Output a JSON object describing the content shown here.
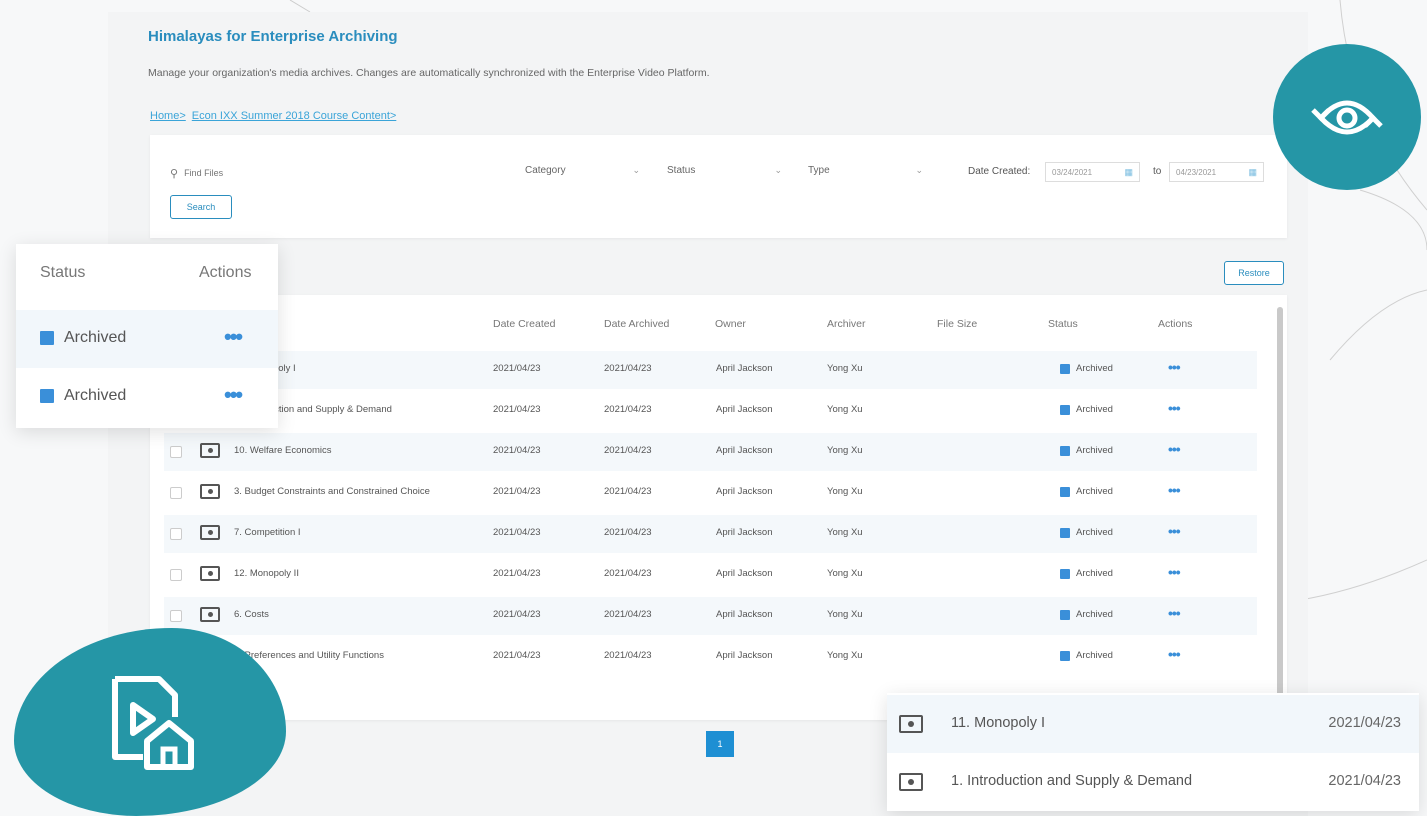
{
  "app": {
    "title": "Himalayas for Enterprise Archiving",
    "description": "Manage your organization's media archives. Changes are automatically synchronized with the Enterprise Video Platform."
  },
  "breadcrumb": [
    "Home>",
    "Econ IXX Summer 2018 Course Content>"
  ],
  "filters": {
    "search_placeholder": "Find Files",
    "category": "Category",
    "status": "Status",
    "type": "Type",
    "date_label": "Date Created:",
    "date_from": "03/24/2021",
    "date_to": "04/23/2021",
    "to_label": "to",
    "search_button": "Search"
  },
  "restore_button": "Restore",
  "table": {
    "columns": [
      "Date Created",
      "Date Archived",
      "Owner",
      "Archiver",
      "File Size",
      "Status",
      "Actions"
    ],
    "rows": [
      {
        "name": "11. Monopoly I",
        "created": "2021/04/23",
        "archived": "2021/04/23",
        "owner": "April Jackson",
        "archiver": "Yong Xu",
        "size": "",
        "status": "Archived"
      },
      {
        "name": "1. Introduction and Supply & Demand",
        "created": "2021/04/23",
        "archived": "2021/04/23",
        "owner": "April Jackson",
        "archiver": "Yong Xu",
        "size": "",
        "status": "Archived"
      },
      {
        "name": "10. Welfare Economics",
        "created": "2021/04/23",
        "archived": "2021/04/23",
        "owner": "April Jackson",
        "archiver": "Yong Xu",
        "size": "",
        "status": "Archived"
      },
      {
        "name": "3. Budget Constraints and Constrained Choice",
        "created": "2021/04/23",
        "archived": "2021/04/23",
        "owner": "April Jackson",
        "archiver": "Yong Xu",
        "size": "",
        "status": "Archived"
      },
      {
        "name": "7. Competition I",
        "created": "2021/04/23",
        "archived": "2021/04/23",
        "owner": "April Jackson",
        "archiver": "Yong Xu",
        "size": "",
        "status": "Archived"
      },
      {
        "name": "12. Monopoly II",
        "created": "2021/04/23",
        "archived": "2021/04/23",
        "owner": "April Jackson",
        "archiver": "Yong Xu",
        "size": "",
        "status": "Archived"
      },
      {
        "name": "6. Costs",
        "created": "2021/04/23",
        "archived": "2021/04/23",
        "owner": "April Jackson",
        "archiver": "Yong Xu",
        "size": "",
        "status": "Archived"
      },
      {
        "name": "2. Preferences and Utility Functions",
        "created": "2021/04/23",
        "archived": "2021/04/23",
        "owner": "April Jackson",
        "archiver": "Yong Xu",
        "size": "",
        "status": "Archived"
      }
    ]
  },
  "pagination": {
    "current": "1"
  },
  "zoom_left": {
    "status_header": "Status",
    "actions_header": "Actions",
    "rows": [
      "Archived",
      "Archived"
    ]
  },
  "zoom_right": {
    "rows": [
      {
        "name": "11. Monopoly I",
        "date": "2021/04/23"
      },
      {
        "name": "1. Introduction and Supply & Demand",
        "date": "2021/04/23"
      }
    ]
  },
  "icons": {
    "sync": "sync-eye-icon",
    "file_home": "video-file-home-icon",
    "search": "search-icon",
    "calendar": "calendar-icon",
    "video": "video-file-icon",
    "more": "more-dots-icon"
  },
  "colors": {
    "accent": "#2a8dbe",
    "status_blue": "#3a8fd9",
    "badge_teal": "#2596a6",
    "pager_blue": "#1e8fd3"
  }
}
